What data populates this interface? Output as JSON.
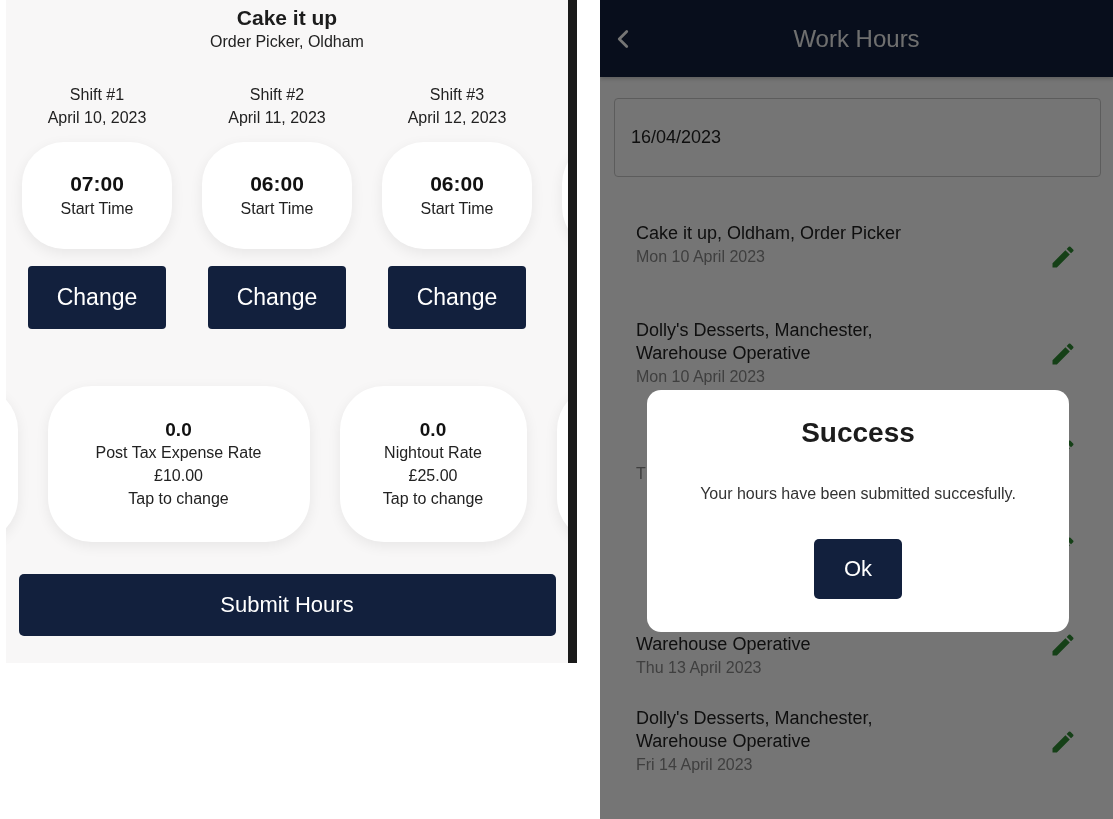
{
  "left_screen": {
    "title": "Cake it up",
    "subtitle": "Order Picker, Oldham",
    "shifts": [
      {
        "label": "Shift #1",
        "date": "April 10, 2023",
        "time": "07:00",
        "time_caption": "Start Time",
        "button": "Change"
      },
      {
        "label": "Shift #2",
        "date": "April 11, 2023",
        "time": "06:00",
        "time_caption": "Start Time",
        "button": "Change"
      },
      {
        "label": "Shift #3",
        "date": "April 12, 2023",
        "time": "06:00",
        "time_caption": "Start Time",
        "button": "Change"
      }
    ],
    "shift_peek": true,
    "rates": [
      {
        "kind": "peek"
      },
      {
        "kind": "rate",
        "value": "0.0",
        "name": "Post Tax Expense Rate",
        "amount": "£10.00",
        "hint": "Tap to change"
      },
      {
        "kind": "rate",
        "value": "0.0",
        "name": "Nightout Rate",
        "amount": "£25.00",
        "hint": "Tap to change"
      },
      {
        "kind": "peek"
      }
    ],
    "submit_button": "Submit Hours"
  },
  "right_screen": {
    "header": {
      "title": "Work Hours"
    },
    "date_field": {
      "value": "16/04/2023"
    },
    "entries": [
      {
        "title_lines": [
          "Cake it up, Oldham, Order Picker"
        ],
        "date": "Mon 10 April 2023"
      },
      {
        "title_lines": [
          "Dolly's Desserts, Manchester,",
          "Warehouse Operative"
        ],
        "date": "Mon 10 April 2023"
      },
      {
        "kind": "covered",
        "date": "T"
      },
      {
        "kind": "covered"
      },
      {
        "kind": "covered",
        "title_lines": [
          "Warehouse Operative"
        ],
        "date": "Thu 13 April 2023"
      },
      {
        "title_lines": [
          "Dolly's Desserts, Manchester,",
          "Warehouse Operative"
        ],
        "date": "Fri 14 April 2023"
      }
    ],
    "dialog": {
      "title": "Success",
      "message": "Your hours have been submitted succesfully.",
      "button": "Ok"
    }
  }
}
